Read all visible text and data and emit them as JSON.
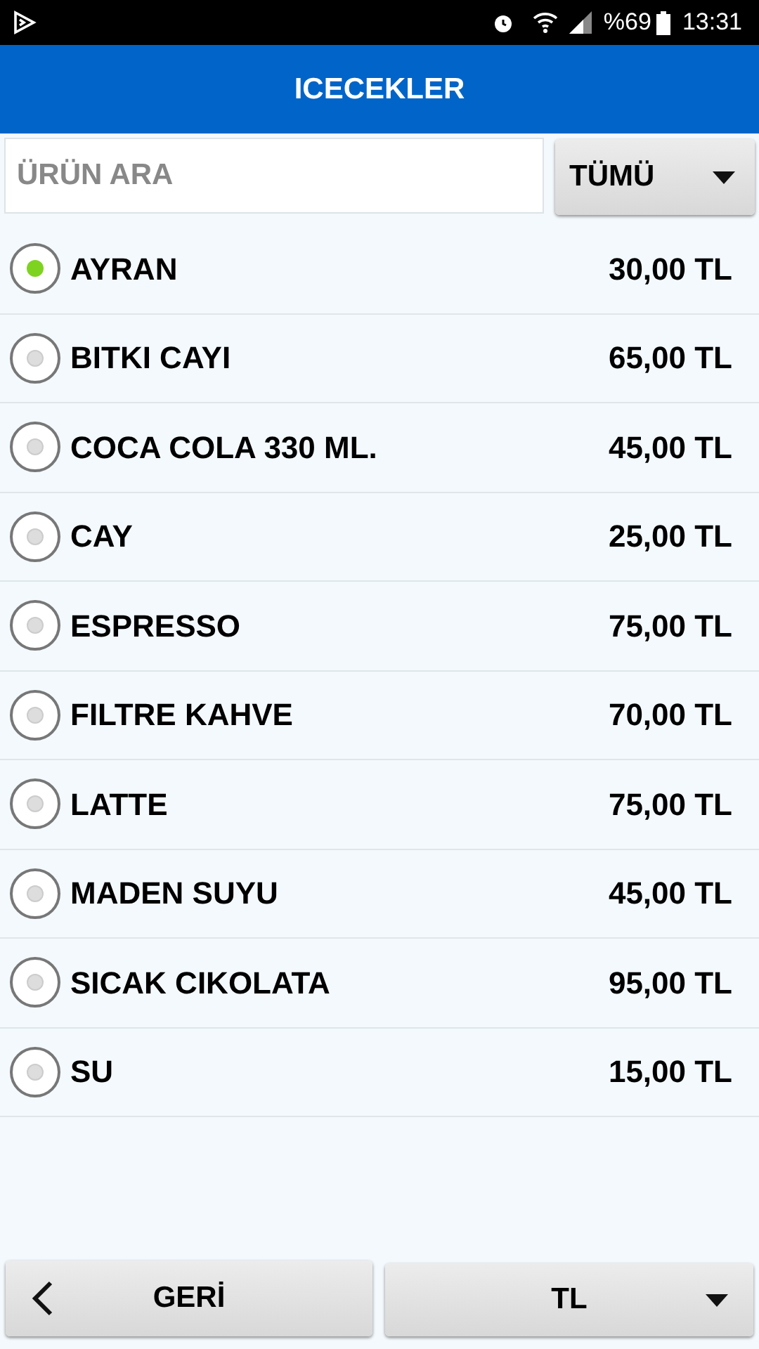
{
  "status_bar": {
    "battery": "%69",
    "time": "13:31"
  },
  "header": {
    "title": "ICECEKLER"
  },
  "search": {
    "placeholder": "ÜRÜN ARA"
  },
  "filter": {
    "value": "TÜMÜ"
  },
  "products": [
    {
      "name": "AYRAN",
      "price": "30,00 TL",
      "selected": true
    },
    {
      "name": "BITKI CAYI",
      "price": "65,00 TL",
      "selected": false
    },
    {
      "name": "COCA COLA 330 ML.",
      "price": "45,00 TL",
      "selected": false
    },
    {
      "name": "CAY",
      "price": "25,00 TL",
      "selected": false
    },
    {
      "name": "ESPRESSO",
      "price": "75,00 TL",
      "selected": false
    },
    {
      "name": "FILTRE KAHVE",
      "price": "70,00 TL",
      "selected": false
    },
    {
      "name": "LATTE",
      "price": "75,00 TL",
      "selected": false
    },
    {
      "name": "MADEN SUYU",
      "price": "45,00 TL",
      "selected": false
    },
    {
      "name": "SICAK CIKOLATA",
      "price": "95,00 TL",
      "selected": false
    },
    {
      "name": "SU",
      "price": "15,00 TL",
      "selected": false
    }
  ],
  "back_button": "GERİ",
  "currency": {
    "value": "TL"
  }
}
